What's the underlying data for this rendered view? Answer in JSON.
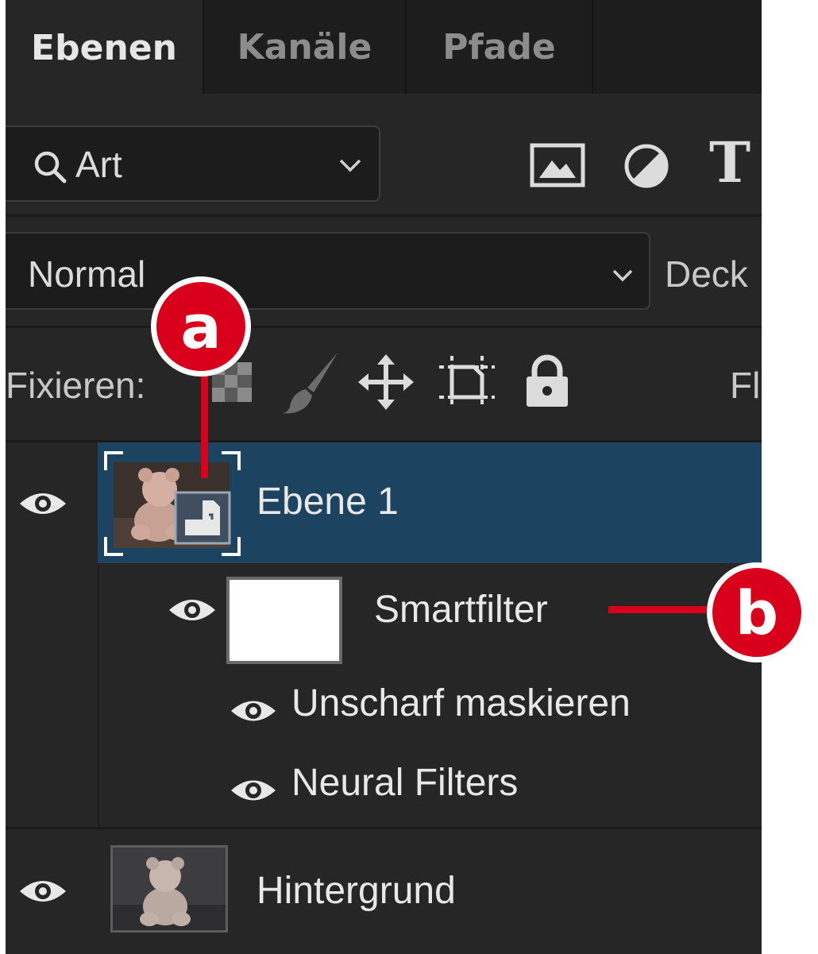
{
  "tabs": [
    {
      "label": "Ebenen",
      "active": true
    },
    {
      "label": "Kanäle",
      "active": false
    },
    {
      "label": "Pfade",
      "active": false
    }
  ],
  "filter": {
    "label": "Art",
    "icons": [
      "search-icon",
      "chevron-down-icon",
      "image-filter-icon",
      "adjustment-filter-icon",
      "type-filter-icon"
    ]
  },
  "blend": {
    "mode": "Normal",
    "opacity_label": "Deck"
  },
  "lock": {
    "label": "Fixieren:",
    "fill_label": "Fl",
    "icons": [
      "lock-transparent-pixels-icon",
      "lock-image-pixels-icon",
      "lock-position-icon",
      "lock-artboard-icon",
      "lock-all-icon"
    ]
  },
  "layers": {
    "ebene1": {
      "name": "Ebene 1",
      "selected": true,
      "type": "smart-object"
    },
    "smartfilter": {
      "name": "Smartfilter"
    },
    "filters": [
      {
        "name": "Unscharf maskieren"
      },
      {
        "name": "Neural Filters"
      }
    ],
    "background": {
      "name": "Hintergrund"
    }
  },
  "callouts": [
    {
      "letter": "a"
    },
    {
      "letter": "b"
    }
  ],
  "colors": {
    "panel_bg": "#262626",
    "selected_layer": "#1c4360",
    "callout": "#d9001b"
  }
}
